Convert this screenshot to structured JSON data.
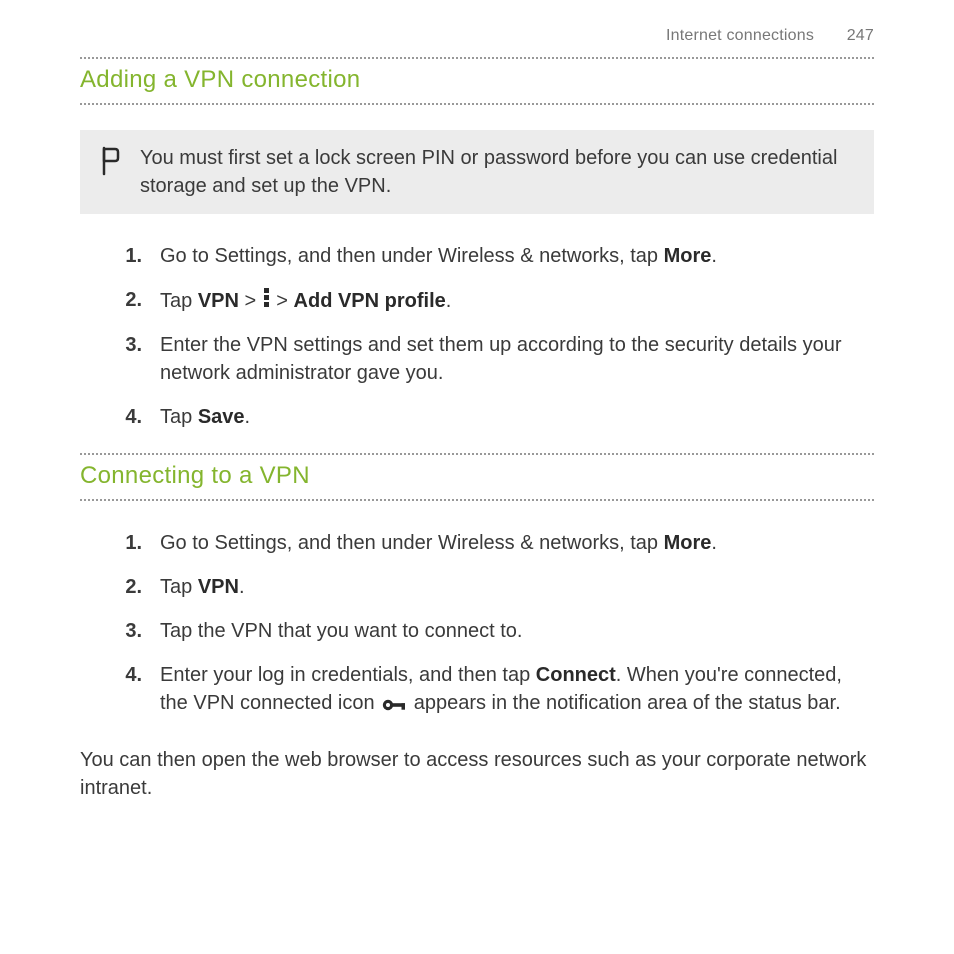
{
  "header": {
    "chapter": "Internet connections",
    "page": "247"
  },
  "section1": {
    "title": "Adding a VPN connection",
    "note": "You must first set a lock screen PIN or password before you can use credential storage and set up the VPN.",
    "steps": {
      "s1a": "Go to Settings, and then under Wireless & networks, tap ",
      "s1b": "More",
      "s1c": ".",
      "s2a": "Tap ",
      "s2b": "VPN",
      "s2c": " > ",
      "s2d": " > ",
      "s2e": "Add VPN profile",
      "s2f": ".",
      "s3": "Enter the VPN settings and set them up according to the security details your network administrator gave you.",
      "s4a": "Tap ",
      "s4b": "Save",
      "s4c": "."
    }
  },
  "section2": {
    "title": "Connecting to a VPN",
    "steps": {
      "s1a": "Go to Settings, and then under Wireless & networks, tap ",
      "s1b": "More",
      "s1c": ".",
      "s2a": "Tap ",
      "s2b": "VPN",
      "s2c": ".",
      "s3": "Tap the VPN that you want to connect to.",
      "s4a": "Enter your log in credentials, and then tap ",
      "s4b": "Connect",
      "s4c": ". When you're connected, the VPN connected icon ",
      "s4d": " appears in the notification area of the status bar."
    },
    "closing": "You can then open the web browser to access resources such as your corporate network intranet."
  }
}
